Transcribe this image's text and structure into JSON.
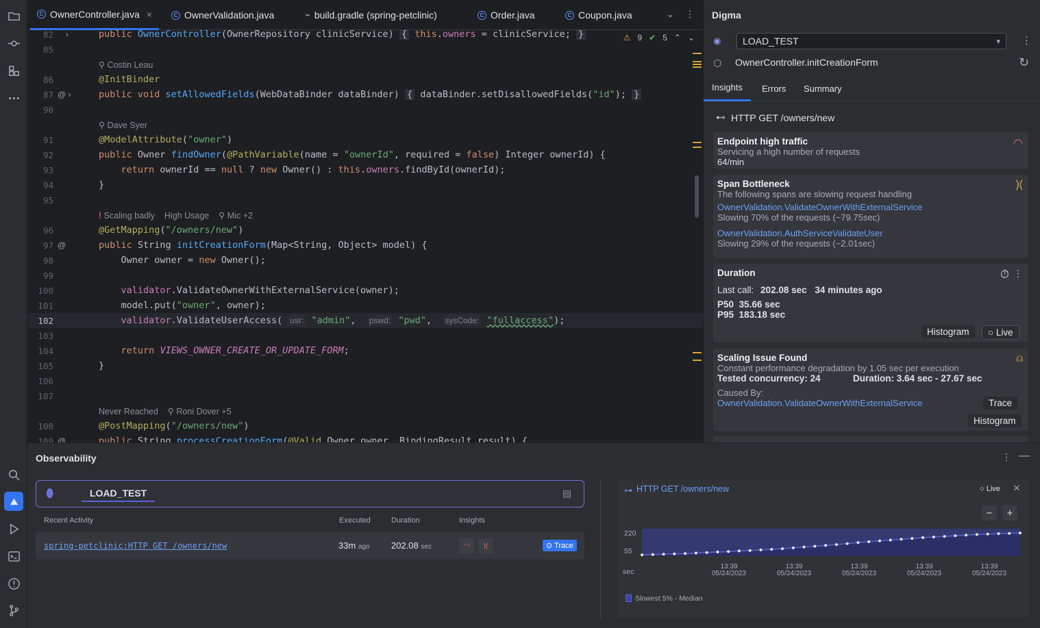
{
  "tabs": [
    {
      "label": "OwnerController.java",
      "active": true
    },
    {
      "label": "OwnerValidation.java",
      "active": false
    },
    {
      "label": "build.gradle (spring-petclinic)",
      "active": false
    },
    {
      "label": "Order.java",
      "active": false
    },
    {
      "label": "Coupon.java",
      "active": false
    }
  ],
  "editor_status": {
    "warnings": "9",
    "checks": "5"
  },
  "code": {
    "l82": "82",
    "l85": "85",
    "l86": "86",
    "l87": "87",
    "l90": "90",
    "l91": "91",
    "l92": "92",
    "l93": "93",
    "l94": "94",
    "l95": "95",
    "l96": "96",
    "l97": "97",
    "l98": "98",
    "l99": "99",
    "l100": "100",
    "l101": "101",
    "l102": "102",
    "l103": "103",
    "l104": "104",
    "l105": "105",
    "l106": "106",
    "l107": "107",
    "l108": "108",
    "l109": "109",
    "author1": "Costin Leau",
    "author2": "Dave Syer",
    "lens_scaling": "Scaling badly",
    "lens_usage": "High Usage",
    "lens_authors": "Mic +2",
    "lens_never": "Never Reached",
    "lens_authors2": "Roni Dover +5"
  },
  "digma": {
    "title": "Digma",
    "environment": "LOAD_TEST",
    "method": "OwnerController.initCreationForm",
    "tabs": [
      "Insights",
      "Errors",
      "Summary"
    ],
    "route": "HTTP GET /owners/new",
    "traffic": {
      "title": "Endpoint high traffic",
      "desc": "Servicing a high number of requests",
      "value": "64/min"
    },
    "bottleneck": {
      "title": "Span Bottleneck",
      "desc": "The following spans are slowing request handling",
      "span1": "OwnerValidation.ValidateOwnerWithExternalService",
      "span1_desc": "Slowing 70% of the requests (~79.75sec)",
      "span2": "OwnerValidation.AuthServiceValidateUser",
      "span2_desc": "Slowing 29% of the requests (~2.01sec)"
    },
    "duration": {
      "title": "Duration",
      "last_call_label": "Last call:",
      "last_call": "202.08 sec",
      "ago": "34 minutes ago",
      "p50_label": "P50",
      "p50": "35.66 sec",
      "p95_label": "P95",
      "p95": "183.18 sec",
      "histogram": "Histogram",
      "live": "Live"
    },
    "scaling": {
      "title": "Scaling Issue Found",
      "desc": "Constant performance degradation by 1.05 sec per execution",
      "concurrency": "Tested concurrency: 24",
      "duration": "Duration: 3.64 sec - 27.67 sec",
      "caused_by": "Caused By:",
      "cause": "OwnerValidation.ValidateOwnerWithExternalService",
      "trace": "Trace",
      "histogram": "Histogram"
    }
  },
  "observability": {
    "title": "Observability",
    "environment": "LOAD_TEST",
    "headers": {
      "recent": "Recent Activity",
      "executed": "Executed",
      "duration": "Duration",
      "insights": "Insights"
    },
    "row": {
      "span": "spring-petclinic:HTTP GET /owners/new",
      "executed": "33m",
      "executed_unit": "ago",
      "duration": "202.08",
      "duration_unit": "sec",
      "trace": "Trace"
    },
    "chart_title": "HTTP GET /owners/new",
    "live": "Live",
    "legend": "Slowest 5% - Median"
  },
  "chart_data": {
    "type": "area",
    "title": "HTTP GET /owners/new",
    "ylabel": "sec",
    "y_ticks": [
      55,
      220
    ],
    "x_ticks": [
      "13:39 05/24/2023",
      "13:39 05/24/2023",
      "13:39 05/24/2023",
      "13:39 05/24/2023",
      "13:39 05/24/2023"
    ],
    "series": [
      {
        "name": "Slowest 5% - Median",
        "values": [
          12,
          15,
          18,
          22,
          25,
          30,
          34,
          40,
          44,
          50,
          54,
          60,
          66,
          72,
          80,
          88,
          96,
          104,
          112,
          122,
          132,
          140,
          148,
          156,
          164,
          172,
          180,
          186,
          192,
          198,
          204,
          210,
          214,
          218,
          221,
          225
        ]
      }
    ],
    "ylim": [
      0,
      240
    ],
    "legend": "bottom-left"
  },
  "colors": {
    "accent": "#3574f0",
    "link": "#6d9ff5",
    "chart": "#5b63d6"
  }
}
